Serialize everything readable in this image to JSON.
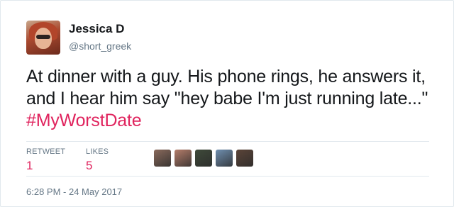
{
  "tweet": {
    "author_name": "Jessica D",
    "author_handle": "@short_greek",
    "text_main": "At dinner with a guy. His phone rings, he answers it, and I hear him say \"hey babe I'm just running late...\"",
    "hashtag": "#MyWorstDate",
    "timestamp": "6:28 PM - 24 May 2017"
  },
  "stats": {
    "retweet_label": "RETWEET",
    "retweet_count": "1",
    "likes_label": "LIKES",
    "likes_count": "5"
  },
  "likers": [
    {
      "name": "liker-avatar-1",
      "color": "#8a6a5c"
    },
    {
      "name": "liker-avatar-2",
      "color": "#b57d6a"
    },
    {
      "name": "liker-avatar-3",
      "color": "#3f4a3a"
    },
    {
      "name": "liker-avatar-4",
      "color": "#6f8fb0"
    },
    {
      "name": "liker-avatar-5",
      "color": "#5b4438"
    }
  ],
  "colors": {
    "hashtag": "#e0245e",
    "muted": "#657786",
    "divider": "#e1e8ed"
  }
}
